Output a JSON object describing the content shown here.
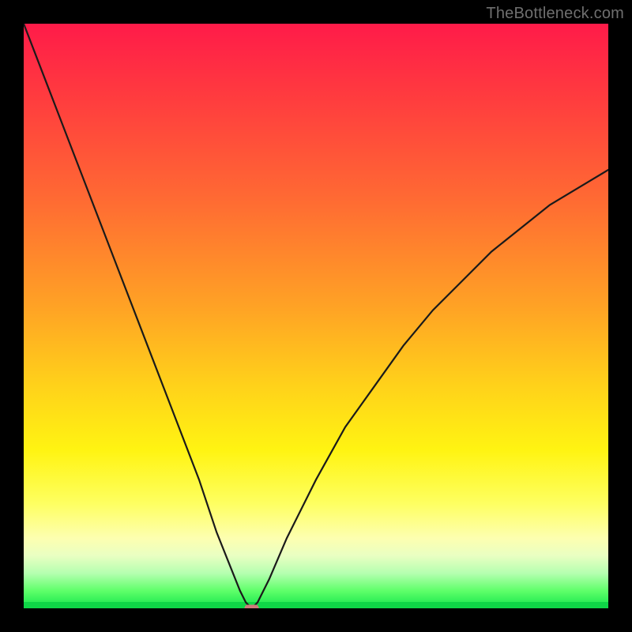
{
  "watermark": {
    "text": "TheBottleneck.com"
  },
  "chart_data": {
    "type": "line",
    "title": "",
    "xlabel": "",
    "ylabel": "",
    "xlim": [
      0,
      100
    ],
    "ylim": [
      0,
      100
    ],
    "grid": false,
    "legend": false,
    "background_gradient": {
      "direction": "top-to-bottom",
      "stops": [
        {
          "pos": 0,
          "color": "#ff1b49"
        },
        {
          "pos": 30,
          "color": "#ff6a33"
        },
        {
          "pos": 62,
          "color": "#ffd21a"
        },
        {
          "pos": 88,
          "color": "#fdffb0"
        },
        {
          "pos": 100,
          "color": "#11e54b"
        }
      ]
    },
    "series": [
      {
        "name": "bottleneck-curve",
        "color": "#1a1a1a",
        "x": [
          0,
          5,
          10,
          15,
          20,
          25,
          30,
          33,
          35,
          37,
          38,
          39,
          40,
          42,
          45,
          50,
          55,
          60,
          65,
          70,
          75,
          80,
          85,
          90,
          95,
          100
        ],
        "y": [
          100,
          87,
          74,
          61,
          48,
          35,
          22,
          13,
          8,
          3,
          1,
          0,
          1,
          5,
          12,
          22,
          31,
          38,
          45,
          51,
          56,
          61,
          65,
          69,
          72,
          75
        ]
      }
    ],
    "annotations": [
      {
        "name": "min-marker",
        "x": 39,
        "y": 0,
        "shape": "rounded-rect",
        "color": "#cf7b7b"
      }
    ]
  }
}
